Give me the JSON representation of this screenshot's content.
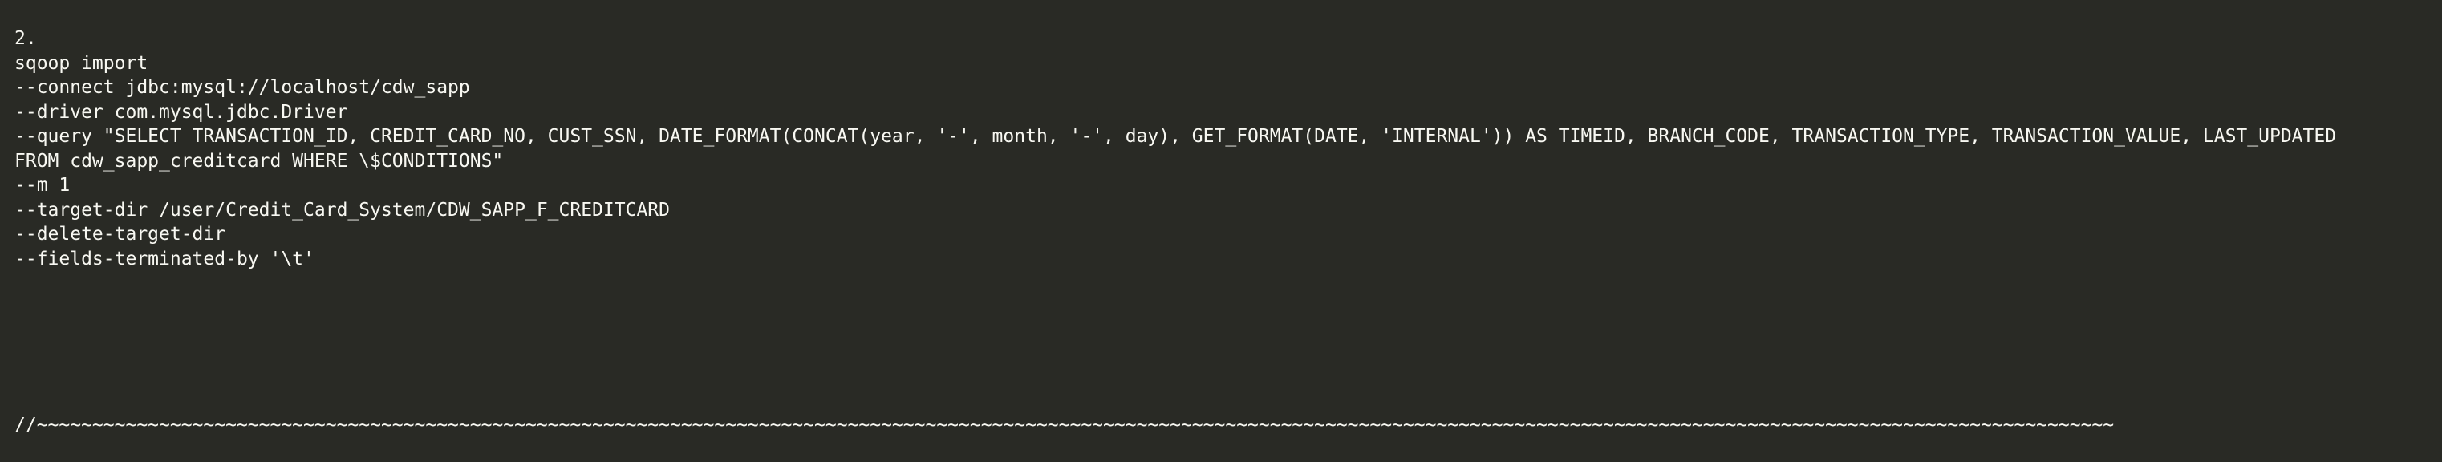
{
  "editor": {
    "lines": [
      "2.",
      "sqoop import",
      "--connect jdbc:mysql://localhost/cdw_sapp",
      "--driver com.mysql.jdbc.Driver",
      "--query \"SELECT TRANSACTION_ID, CREDIT_CARD_NO, CUST_SSN, DATE_FORMAT(CONCAT(year, '-', month, '-', day), GET_FORMAT(DATE, 'INTERNAL')) AS TIMEID, BRANCH_CODE, TRANSACTION_TYPE, TRANSACTION_VALUE, LAST_UPDATED",
      "FROM cdw_sapp_creditcard WHERE \\$CONDITIONS\"",
      "--m 1",
      "--target-dir /user/Credit_Card_System/CDW_SAPP_F_CREDITCARD",
      "--delete-target-dir",
      "--fields-terminated-by '\\t'"
    ],
    "comment_line": "//~~~~~~~~~~~~~~~~~~~~~~~~~~~~~~~~~~~~~~~~~~~~~~~~~~~~~~~~~~~~~~~~~~~~~~~~~~~~~~~~~~~~~~~~~~~~~~~~~~~~~~~~~~~~~~~~~~~~~~~~~~~~~~~~~~~~~~~~~~~~~~~~~~~~~~~~~~~~~~~~~~~~~~~~~~~~~~~~~~~~~~~~~~~"
  }
}
